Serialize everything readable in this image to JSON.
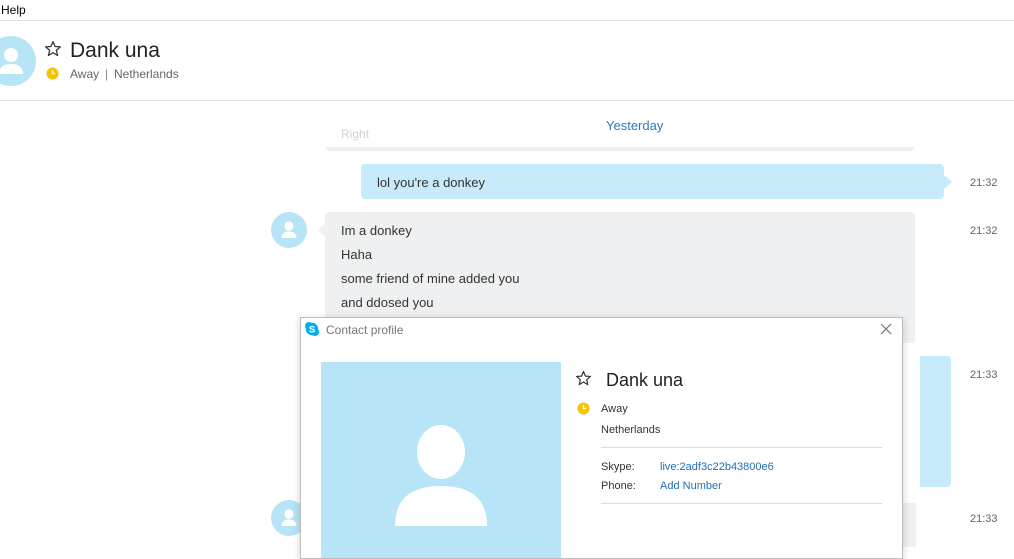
{
  "menu": {
    "help_label": "Help"
  },
  "header": {
    "contact_name": "Dank una",
    "status": "Away",
    "separator": "|",
    "location": "Netherlands"
  },
  "conversation": {
    "faded_previous_text": "Right",
    "date_divider": "Yesterday",
    "messages": [
      {
        "direction": "outgoing",
        "lines": [
          "lol you're a donkey"
        ],
        "time": "21:32"
      },
      {
        "direction": "incoming",
        "lines": [
          "Im a donkey",
          "Haha",
          "some friend of mine added you",
          "and ddosed you"
        ],
        "time": "21:32"
      },
      {
        "direction": "outgoing",
        "lines": [],
        "time": "21:33"
      },
      {
        "direction": "incoming",
        "lines": [],
        "time": "21:33"
      }
    ]
  },
  "profile_dialog": {
    "title": "Contact profile",
    "name": "Dank una",
    "status": "Away",
    "location": "Netherlands",
    "skype_label": "Skype:",
    "skype_id": "live:2adf3c22b43800e6",
    "phone_label": "Phone:",
    "phone_action": "Add Number"
  },
  "colors": {
    "accent": "#2b7bb5",
    "outgoing_bubble": "#c7ebfa",
    "incoming_bubble": "#eef0f2",
    "avatar_bg": "#b8e4f7",
    "away_status": "#f5c400"
  },
  "icons": [
    "star-icon",
    "clock-icon",
    "avatar-icon",
    "skype-logo-icon",
    "close-icon"
  ]
}
